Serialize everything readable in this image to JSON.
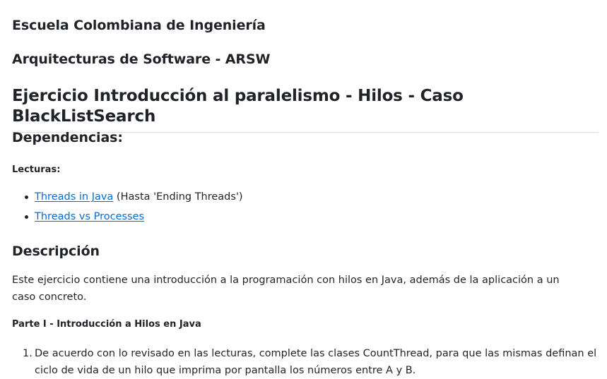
{
  "document": {
    "school": "Escuela Colombiana de Ingeniería",
    "course": "Arquitecturas de Software - ARSW",
    "title": "Ejercicio Introducción al paralelismo - Hilos - Caso BlackListSearch",
    "dependencies": {
      "heading": "Dependencias:",
      "readings_heading": "Lecturas:",
      "readings": [
        {
          "link_text": "Threads in Java",
          "suffix": " (Hasta 'Ending Threads')"
        },
        {
          "link_text": "Threads vs Processes",
          "suffix": ""
        }
      ]
    },
    "description": {
      "heading": "Descripción",
      "text": "Este ejercicio contiene una introducción a la programación con hilos en Java, además de la aplicación a un caso concreto."
    },
    "part1": {
      "heading": "Parte I - Introducción a Hilos en Java",
      "items": [
        {
          "number": "1.",
          "text": "De acuerdo con lo revisado en las lecturas, complete las clases CountThread, para que las mismas definan el ciclo de vida de un hilo que imprima por pantalla los números entre A y B."
        }
      ]
    }
  },
  "colors": {
    "text": "#1f2328",
    "link": "#0969da",
    "divider": "#d8dee4"
  }
}
